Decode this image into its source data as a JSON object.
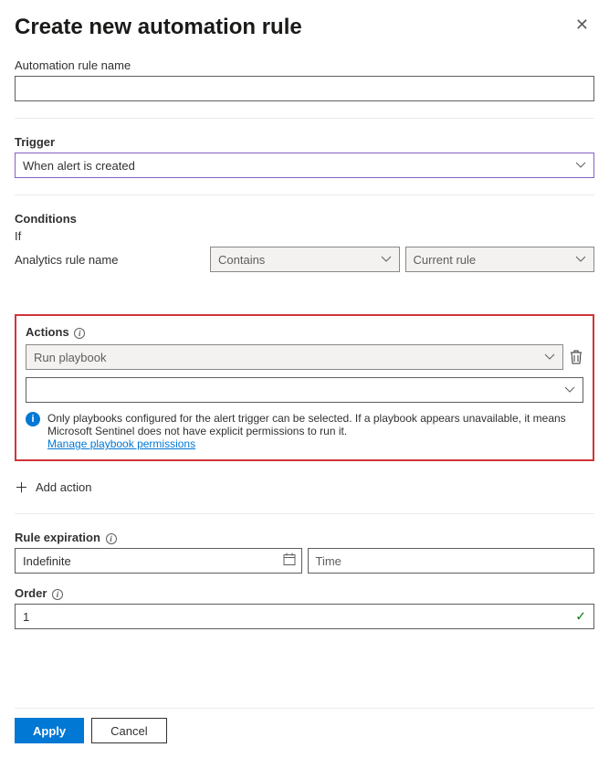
{
  "header": {
    "title": "Create new automation rule"
  },
  "rule_name": {
    "label": "Automation rule name",
    "value": ""
  },
  "trigger": {
    "label": "Trigger",
    "selected": "When alert is created"
  },
  "conditions": {
    "label": "Conditions",
    "if_label": "If",
    "field_label": "Analytics rule name",
    "operator": "Contains",
    "value": "Current rule"
  },
  "actions": {
    "label": "Actions",
    "action_type": "Run playbook",
    "playbook_selected": "",
    "info_text": "Only playbooks configured for the alert trigger can be selected. If a playbook appears unavailable, it means Microsoft Sentinel does not have explicit permissions to run it.",
    "link_text": "Manage playbook permissions",
    "add_label": "Add action"
  },
  "expiration": {
    "label": "Rule expiration",
    "date_value": "Indefinite",
    "time_value": "",
    "time_placeholder": "Time"
  },
  "order": {
    "label": "Order",
    "value": "1"
  },
  "footer": {
    "apply": "Apply",
    "cancel": "Cancel"
  }
}
